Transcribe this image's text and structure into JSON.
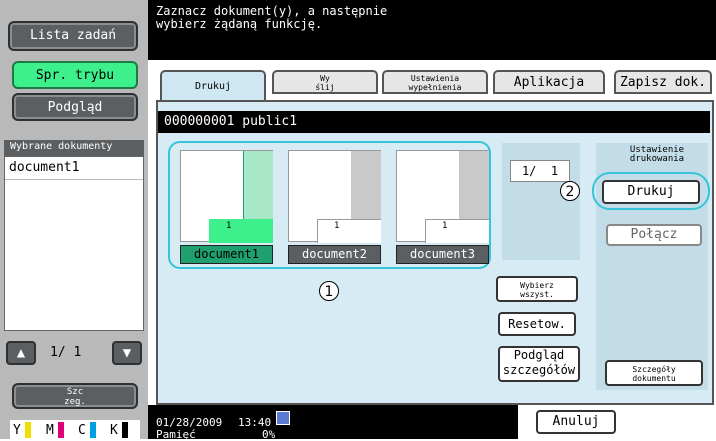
{
  "sidebar": {
    "job_list_label": "Lista zadań",
    "mode_check_label": "Spr. trybu",
    "preview_label": "Podgląd",
    "selected_header": "Wybrane dokumenty",
    "selected_items": [
      "document1"
    ],
    "page_indicator": "1/ 1",
    "details_label": "Szc\nzeg.",
    "toner": [
      "Y",
      "M",
      "C",
      "K"
    ]
  },
  "header": {
    "message": "Zaznacz dokument(y), a następnie\nwybierz żądaną funkcję."
  },
  "tabs": [
    {
      "label": "Drukuj",
      "active": true
    },
    {
      "label": "Wy\nślij",
      "active": false
    },
    {
      "label": "Ustawienia\nwypełnienia",
      "active": false
    },
    {
      "label": "Aplikacja",
      "active": false
    },
    {
      "label": "Zapisz dok.",
      "active": false
    }
  ],
  "path": "000000001  public1",
  "documents": [
    {
      "name": "document1",
      "pages": "1",
      "selected": true
    },
    {
      "name": "document2",
      "pages": "1",
      "selected": false
    },
    {
      "name": "document3",
      "pages": "1",
      "selected": false
    }
  ],
  "page_counter": "1/  1",
  "buttons": {
    "select_all": "Wybierz\nwszyst.",
    "reset": "Resetow.",
    "detail_preview": "Podgląd\nszczegółów",
    "print_settings_header": "Ustawienie\ndrukowania",
    "print": "Drukuj",
    "combine": "Połącz",
    "doc_details": "Szczegóły\ndokumentu",
    "cancel": "Anuluj"
  },
  "callouts": [
    "1",
    "2"
  ],
  "status": {
    "date": "01/28/2009",
    "time": "13:40",
    "memory_label": "Pamięć",
    "memory_value": "0%"
  },
  "colors": {
    "accent_green": "#3df08c",
    "selection_teal": "#20a071",
    "callout_cyan": "#35c5d8",
    "panel_blue": "#d6ebf3"
  }
}
